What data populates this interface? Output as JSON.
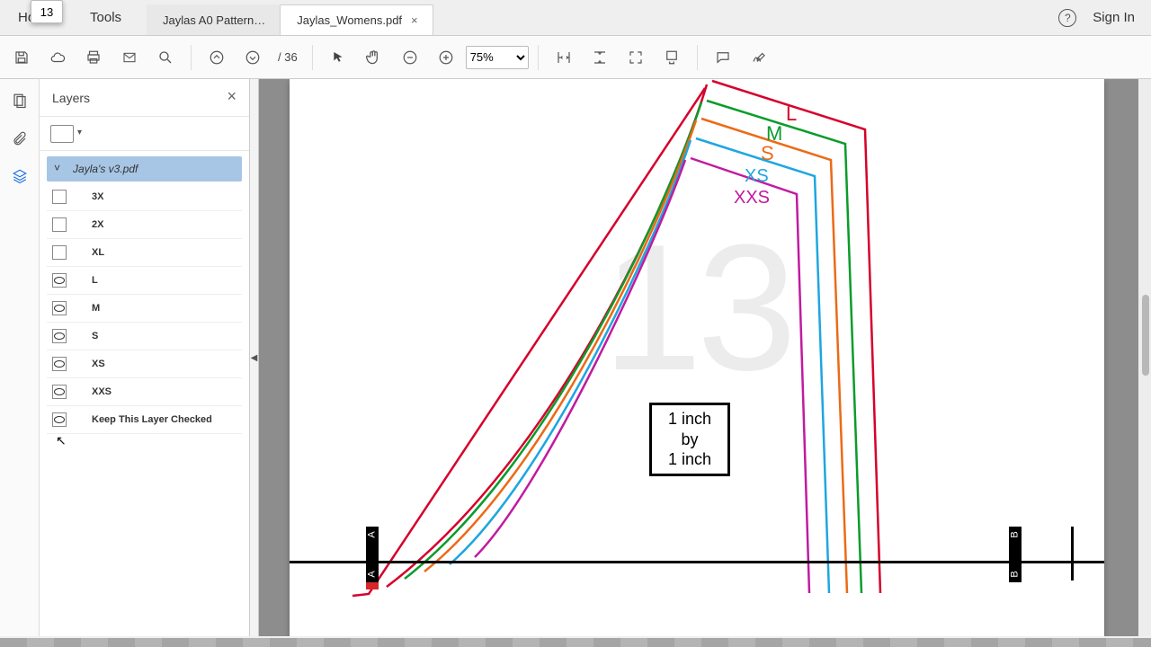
{
  "menu": {
    "home": "Home",
    "tools": "Tools",
    "sign_in": "Sign In",
    "help_glyph": "?"
  },
  "tabs": [
    {
      "label": "Jaylas A0 Pattern…",
      "active": false
    },
    {
      "label": "Jaylas_Womens.pdf",
      "active": true,
      "close": "×"
    }
  ],
  "toolbar": {
    "page_current": "13",
    "page_total": "/ 36",
    "zoom": "75%"
  },
  "layers_panel": {
    "title": "Layers",
    "root": "Jayla's v3.pdf",
    "items": [
      {
        "name": "3X",
        "visible": false
      },
      {
        "name": "2X",
        "visible": false
      },
      {
        "name": "XL",
        "visible": false
      },
      {
        "name": "L",
        "visible": true
      },
      {
        "name": "M",
        "visible": true
      },
      {
        "name": "S",
        "visible": true
      },
      {
        "name": "XS",
        "visible": true
      },
      {
        "name": "XXS",
        "visible": true
      },
      {
        "name": "Keep This Layer Checked",
        "visible": true,
        "keep": true
      }
    ]
  },
  "page": {
    "number_watermark": "13",
    "inch_box": {
      "l1": "1 inch",
      "l2": "by",
      "l3": "1 inch"
    },
    "marker_a": "A",
    "marker_b": "B",
    "size_labels": {
      "L": "L",
      "M": "M",
      "S": "S",
      "XS": "XS",
      "XXS": "XXS"
    },
    "colors": {
      "L": "#d6002b",
      "M": "#0a9c2a",
      "S": "#ec6a16",
      "XS": "#1ea6e0",
      "XXS": "#c11aa0"
    }
  }
}
